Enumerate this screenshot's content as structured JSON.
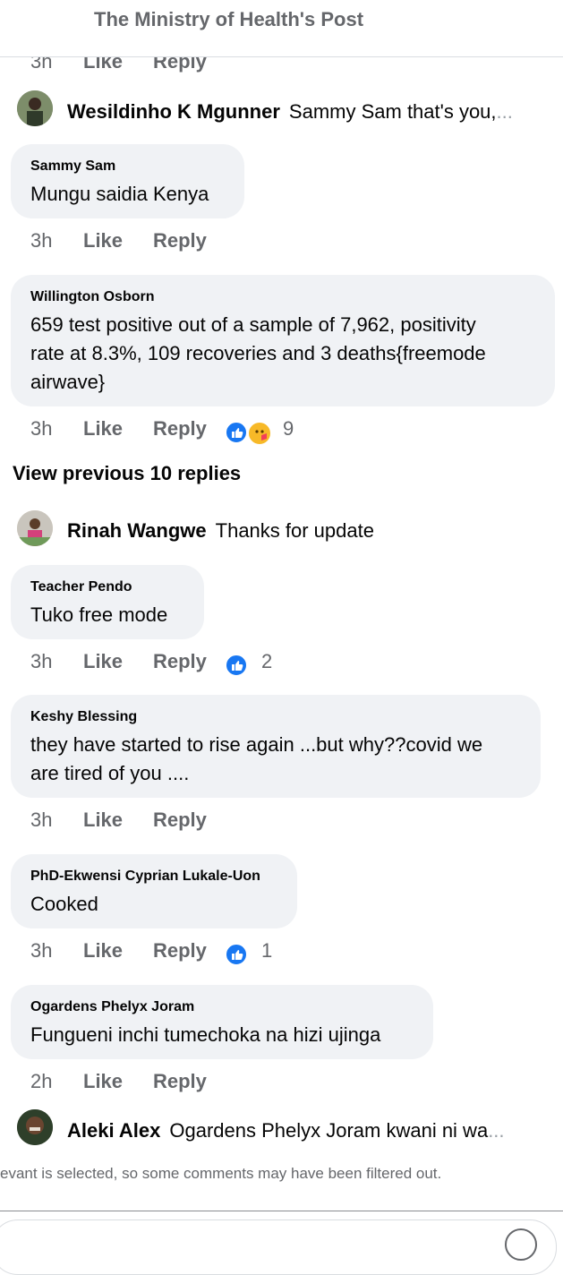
{
  "header": {
    "title": "The Ministry of Health's Post"
  },
  "top_meta": {
    "time": "3h",
    "like": "Like",
    "reply": "Reply"
  },
  "reply_rows": [
    {
      "name": "Wesildinho K Mgunner",
      "snippet": "Sammy Sam that's you,",
      "ellipsis": "..."
    },
    {
      "name": "Rinah Wangwe",
      "snippet": "Thanks for update",
      "ellipsis": ""
    },
    {
      "name": "Aleki Alex",
      "snippet": "Ogardens Phelyx Joram kwani ni wa",
      "ellipsis": "..."
    }
  ],
  "comments": [
    {
      "author": "Sammy Sam",
      "text": "Mungu saidia Kenya",
      "time": "3h",
      "like": "Like",
      "reply": "Reply",
      "reactions": ""
    },
    {
      "author": "Willington Osborn",
      "text_lines": [
        "659 test positive out of a sample of 7,962, positivity",
        "rate at 8.3%,  109 recoveries  and 3 deaths{freemode",
        "airwave}"
      ],
      "time": "3h",
      "like": "Like",
      "reply": "Reply",
      "reactions": "9"
    },
    {
      "author": "Teacher Pendo",
      "text": "Tuko free mode",
      "time": "3h",
      "like": "Like",
      "reply": "Reply",
      "reactions": "2"
    },
    {
      "author": "Keshy Blessing",
      "text_lines": [
        "they have started to rise again ...but why??covid we",
        "are tired of you ...."
      ],
      "time": "3h",
      "like": "Like",
      "reply": "Reply",
      "reactions": ""
    },
    {
      "author": "PhD-Ekwensi Cyprian Lukale-Uon",
      "text": "Cooked",
      "time": "3h",
      "like": "Like",
      "reply": "Reply",
      "reactions": "1"
    },
    {
      "author": "Ogardens Phelyx Joram",
      "text": "Fungueni inchi tumechoka na hizi ujinga",
      "time": "2h",
      "like": "Like",
      "reply": "Reply",
      "reactions": ""
    }
  ],
  "view_previous": "View previous 10 replies",
  "filter_note": "evant is selected, so some comments may have been filtered out.",
  "colors": {
    "like_blue": "#1877f2",
    "care_yellow": "#f7b928",
    "bubble_bg": "#f0f2f5",
    "meta_gray": "#65676b"
  },
  "icons": {
    "like": "thumbs-up-icon",
    "care": "care-hug-icon",
    "emoji": "emoji-icon"
  }
}
